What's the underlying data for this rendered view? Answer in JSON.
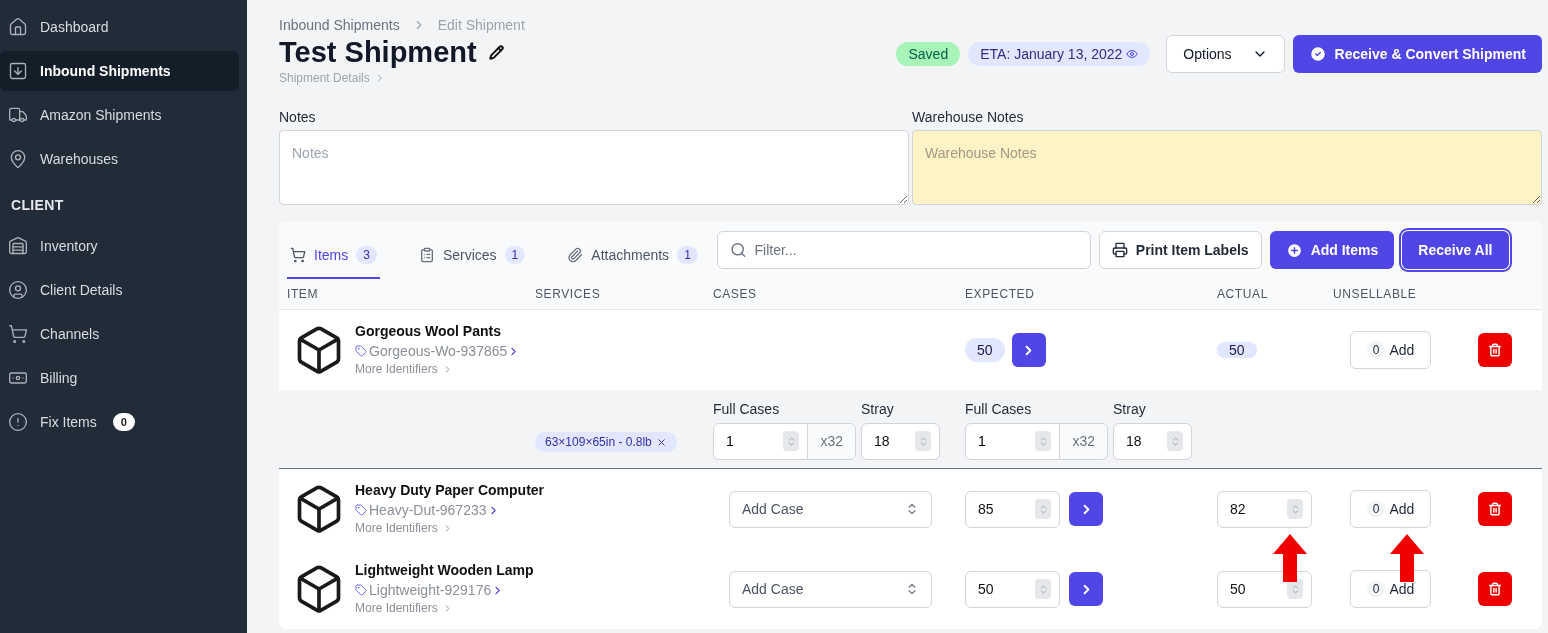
{
  "sidebar": {
    "items": [
      {
        "label": "Dashboard",
        "selected": false
      },
      {
        "label": "Inbound Shipments",
        "selected": true
      },
      {
        "label": "Amazon Shipments",
        "selected": false
      },
      {
        "label": "Warehouses",
        "selected": false
      }
    ],
    "section": "CLIENT",
    "client_items": [
      {
        "label": "Inventory",
        "selected": false
      },
      {
        "label": "Client Details",
        "selected": false
      },
      {
        "label": "Channels",
        "selected": false
      },
      {
        "label": "Billing",
        "selected": false
      },
      {
        "label": "Fix Items",
        "selected": false,
        "badge": "0"
      }
    ]
  },
  "breadcrumb": [
    "Inbound Shipments",
    "Edit Shipment"
  ],
  "title": "Test Shipment",
  "subtitle": "Shipment Details",
  "status": "Saved",
  "eta": "ETA: January 13, 2022",
  "options_button": "Options",
  "primary_button": "Receive & Convert Shipment",
  "notes": {
    "label": "Notes",
    "placeholder": "Notes"
  },
  "warehouse_notes": {
    "label": "Warehouse Notes",
    "placeholder": "Warehouse Notes"
  },
  "tabs": [
    {
      "label": "Items",
      "count": "3",
      "selected": true
    },
    {
      "label": "Services",
      "count": "1",
      "selected": false
    },
    {
      "label": "Attachments",
      "count": "1",
      "selected": false
    }
  ],
  "filter": {
    "placeholder": "Filter..."
  },
  "print_button": "Print Item Labels",
  "add_button": "Add Items",
  "receive_all_button": "Receive All",
  "columns": [
    "ITEM",
    "SERVICES",
    "CASES",
    "EXPECTED",
    "ACTUAL",
    "UNSELLABLE"
  ],
  "rows": [
    {
      "kind": "summary",
      "name": "Gorgeous Wool Pants",
      "sku": "Gorgeous-Wo-937865",
      "more": "More Identifiers",
      "expected": "50",
      "actual": "50",
      "unsellable": "0",
      "add": "Add",
      "case_detail": {
        "tag": "63×109×65in - 0.8lb",
        "groups": [
          {
            "full_label": "Full Cases",
            "full_value": "1",
            "multiplier": "x32",
            "stray_label": "Stray",
            "stray_value": "18"
          },
          {
            "full_label": "Full Cases",
            "full_value": "1",
            "multiplier": "x32",
            "stray_label": "Stray",
            "stray_value": "18"
          }
        ]
      }
    },
    {
      "kind": "editable",
      "name": "Heavy Duty Paper Computer",
      "sku": "Heavy-Dut-967233",
      "more": "More Identifiers",
      "case_placeholder": "Add Case",
      "expected": "85",
      "actual": "82",
      "unsellable": "0",
      "add": "Add"
    },
    {
      "kind": "editable",
      "name": "Lightweight Wooden Lamp",
      "sku": "Lightweight-929176",
      "more": "More Identifiers",
      "case_placeholder": "Add Case",
      "expected": "50",
      "actual": "50",
      "unsellable": "0",
      "add": "Add"
    }
  ]
}
